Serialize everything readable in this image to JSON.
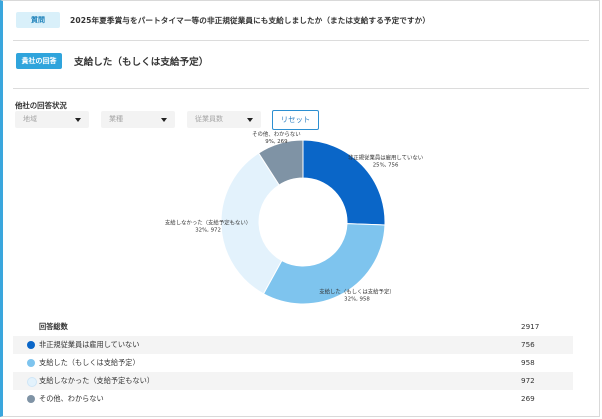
{
  "question": {
    "badge": "質問",
    "text": "2025年夏季賞与をパートタイマー等の非正規従業員にも支給しましたか（または支給する予定ですか）"
  },
  "answer": {
    "badge": "貴社の回答",
    "text": "支給した（もしくは支給予定）"
  },
  "others": {
    "title": "他社の回答状況",
    "filters": [
      {
        "placeholder": "地域"
      },
      {
        "placeholder": "業種"
      },
      {
        "placeholder": "従業員数"
      }
    ],
    "reset_label": "リセット"
  },
  "chart_data": {
    "type": "pie",
    "donut": true,
    "slices": [
      {
        "label": "非正規従業員は雇用していない",
        "percent": 25,
        "count": 756,
        "value_text": "25%, 756",
        "color": "#0a66c8"
      },
      {
        "label": "支給した（もしくは支給予定）",
        "percent": 32,
        "count": 958,
        "value_text": "32%, 958",
        "color": "#7ec4ee"
      },
      {
        "label": "支給しなかった（支給予定もない）",
        "percent": 32,
        "count": 972,
        "value_text": "32%, 972",
        "color": "#e3f2fc"
      },
      {
        "label": "その他、わからない",
        "percent": 9,
        "count": 269,
        "value_text": "9%, 269",
        "color": "#7f93a5"
      }
    ]
  },
  "table": {
    "total_label": "回答総数",
    "total_value": "2917",
    "rows": [
      {
        "label": "非正規従業員は雇用していない",
        "value": "756"
      },
      {
        "label": "支給した（もしくは支給予定）",
        "value": "958"
      },
      {
        "label": "支給しなかった（支給予定もない）",
        "value": "972"
      },
      {
        "label": "その他、わからない",
        "value": "269"
      }
    ]
  }
}
